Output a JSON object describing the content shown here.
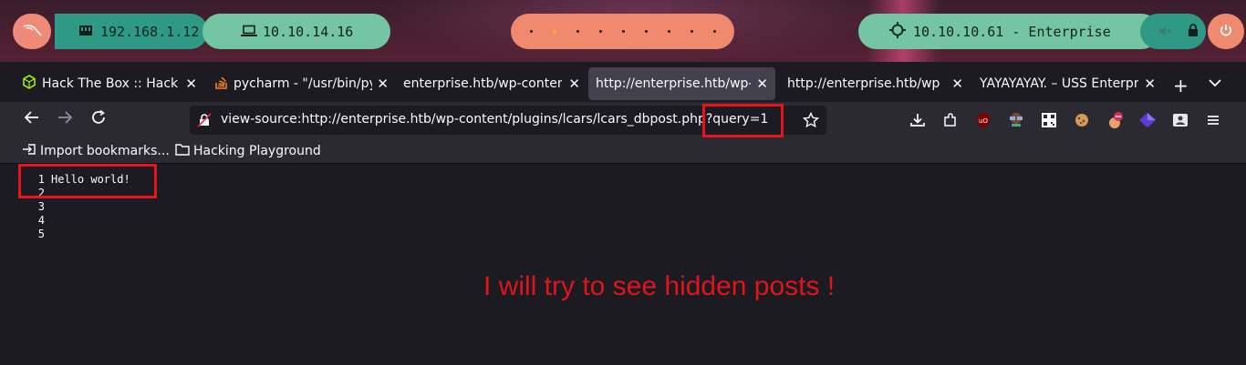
{
  "os_bar": {
    "lan_ip": "192.168.1.12",
    "vpn_ip": "10.10.14.16",
    "workspaces": [
      "",
      "",
      "",
      "",
      "",
      "",
      "",
      "",
      ""
    ],
    "active_workspace": 2,
    "target": "10.10.10.61 - Enterprise"
  },
  "tabs": [
    {
      "label": "Hack The Box :: Hack T",
      "icon": "htb-icon"
    },
    {
      "label": "pycharm - \"/usr/bin/pyt",
      "icon": "stackoverflow-icon"
    },
    {
      "label": "enterprise.htb/wp-content",
      "icon": ""
    },
    {
      "label": "http://enterprise.htb/wp-co",
      "icon": "",
      "active": true
    },
    {
      "label": "http://enterprise.htb/wp-co",
      "icon": ""
    },
    {
      "label": "YAYAYAYAY. – USS Enterprise",
      "icon": ""
    }
  ],
  "url": {
    "prefix": "view-source:http://enterprise.htb/wp-content/plugins/lcars/lcars_dbpost.php",
    "query": "?query=1"
  },
  "bookmarks": [
    {
      "label": "Import bookmarks...",
      "icon": "import-icon"
    },
    {
      "label": "Hacking Playground",
      "icon": "folder-icon"
    }
  ],
  "source_lines": [
    {
      "num": "1",
      "text": "Hello world!"
    },
    {
      "num": "2",
      "text": ""
    },
    {
      "num": "3",
      "text": ""
    },
    {
      "num": "4",
      "text": ""
    },
    {
      "num": "5",
      "text": ""
    }
  ],
  "annotation": "I will try to see hidden posts !",
  "colors": {
    "annotation_red": "#e0141b",
    "pill_teal": "#2e9a86",
    "pill_green": "#74c6a2",
    "pill_orange": "#f08a6e"
  }
}
